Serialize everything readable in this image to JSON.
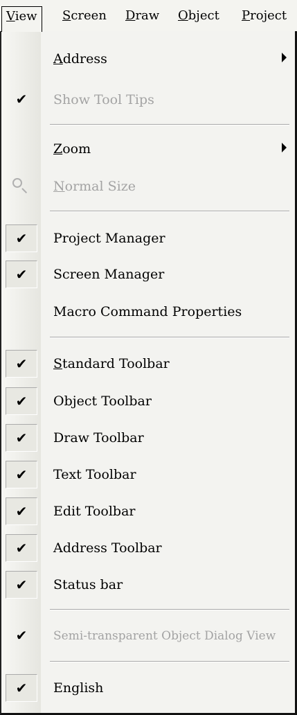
{
  "menubar": {
    "items": [
      "View",
      "Screen",
      "Draw",
      "Object",
      "Project"
    ],
    "accel": [
      "V",
      "S",
      "D",
      "O",
      "P"
    ]
  },
  "menu": {
    "address": "Address",
    "show_tool_tips": "Show Tool Tips",
    "zoom": "Zoom",
    "normal_size": "Normal Size",
    "project_manager": "Project Manager",
    "screen_manager": "Screen Manager",
    "macro_command_properties": "Macro Command Properties",
    "standard_toolbar": "Standard Toolbar",
    "object_toolbar": "Object Toolbar",
    "draw_toolbar": "Draw Toolbar",
    "text_toolbar": "Text Toolbar",
    "edit_toolbar": "Edit Toolbar",
    "address_toolbar": "Address Toolbar",
    "status_bar": "Status bar",
    "semi_transparent": "Semi-transparent Object Dialog View",
    "english": "English"
  },
  "checks": {
    "show_tool_tips": true,
    "project_manager": true,
    "screen_manager": true,
    "standard_toolbar": true,
    "object_toolbar": true,
    "draw_toolbar": true,
    "text_toolbar": true,
    "edit_toolbar": true,
    "address_toolbar": true,
    "status_bar": true,
    "semi_transparent": true,
    "english": true
  },
  "check_glyph": "✔"
}
